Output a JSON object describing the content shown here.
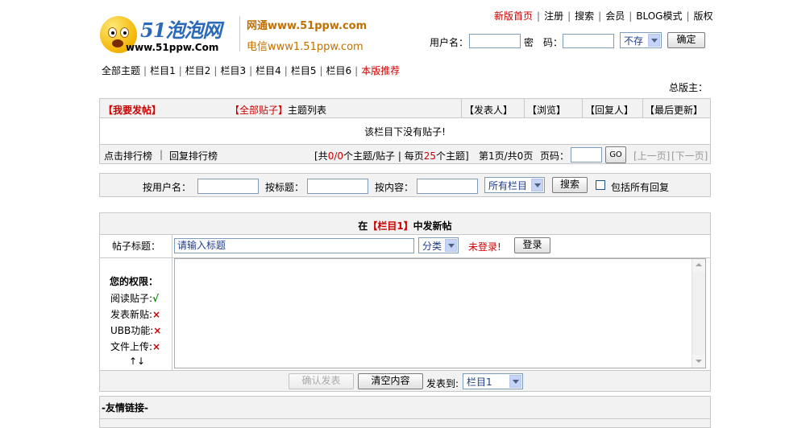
{
  "header": {
    "logo_text": "51泡泡网",
    "logo_url": "www.51ppw.Com",
    "isp1": "网通www.51ppw.com",
    "isp2": "电信www1.51ppw.com"
  },
  "topnav": {
    "items": [
      "新版首页",
      "注册",
      "搜索",
      "会员",
      "BLOG模式",
      "版权"
    ]
  },
  "login": {
    "username_label": "用户名：",
    "password_label_1": "密",
    "password_label_2": "码：",
    "remember_value": "不存",
    "confirm_label": "确定"
  },
  "catnav": {
    "items": [
      "全部主题",
      "栏目1",
      "栏目2",
      "栏目3",
      "栏目4",
      "栏目5",
      "栏目6",
      "本版推荐"
    ]
  },
  "moderator": "总版主：",
  "thread_list": {
    "post_link": "【我要发帖】",
    "all_posts_link": "【全部贴子】",
    "list_title": "主题列表",
    "columns": [
      "【发表人】",
      "【浏览】",
      "【回复人】",
      "【最后更新】"
    ],
    "empty_message": "该栏目下没有贴子!",
    "click_rank": "点击排行榜",
    "reply_rank": "回复排行榜",
    "stats": {
      "open": "[共",
      "count": "0/0",
      "mid": "个主题/贴子 | 每页",
      "per_page": "25",
      "end": "个主题]",
      "page_info": "第1页/共0页",
      "page_label": "页码：",
      "go": "GO",
      "prev": "[上一页]",
      "next": "[下一页]"
    }
  },
  "search": {
    "by_user": "按用户名：",
    "by_title": "按标题：",
    "by_content": "按内容：",
    "section_value": "所有栏目",
    "search_button": "搜索",
    "include_replies": "包括所有回复"
  },
  "new_post": {
    "header_prefix": "在",
    "header_section": "【栏目1】",
    "header_suffix": "中发新帖",
    "title_label": "帖子标题：",
    "title_placeholder": "请输入标题",
    "category_value": "分类",
    "not_logged_in": "未登录!",
    "login_button": "登录",
    "permissions_title": "您的权限：",
    "permissions": [
      {
        "label": "阅读贴子:",
        "mark": "√"
      },
      {
        "label": "发表新贴:",
        "mark": "×"
      },
      {
        "label": "UBB功能:",
        "mark": "×"
      },
      {
        "label": "文件上传:",
        "mark": "×"
      }
    ],
    "resize_arrows": "↑↓",
    "confirm_button": "确认发表",
    "clear_button": "清空内容",
    "post_to_label": "发表到:",
    "post_to_value": "栏目1"
  },
  "friend_links": {
    "title": "-友情链接-"
  },
  "colors": {
    "accent_red": "#cc0000",
    "brand_blue": "#2a6ab8",
    "isp_orange": "#c07000",
    "bar_bg": "#f2f2f2",
    "border": "#c8c8c8"
  }
}
